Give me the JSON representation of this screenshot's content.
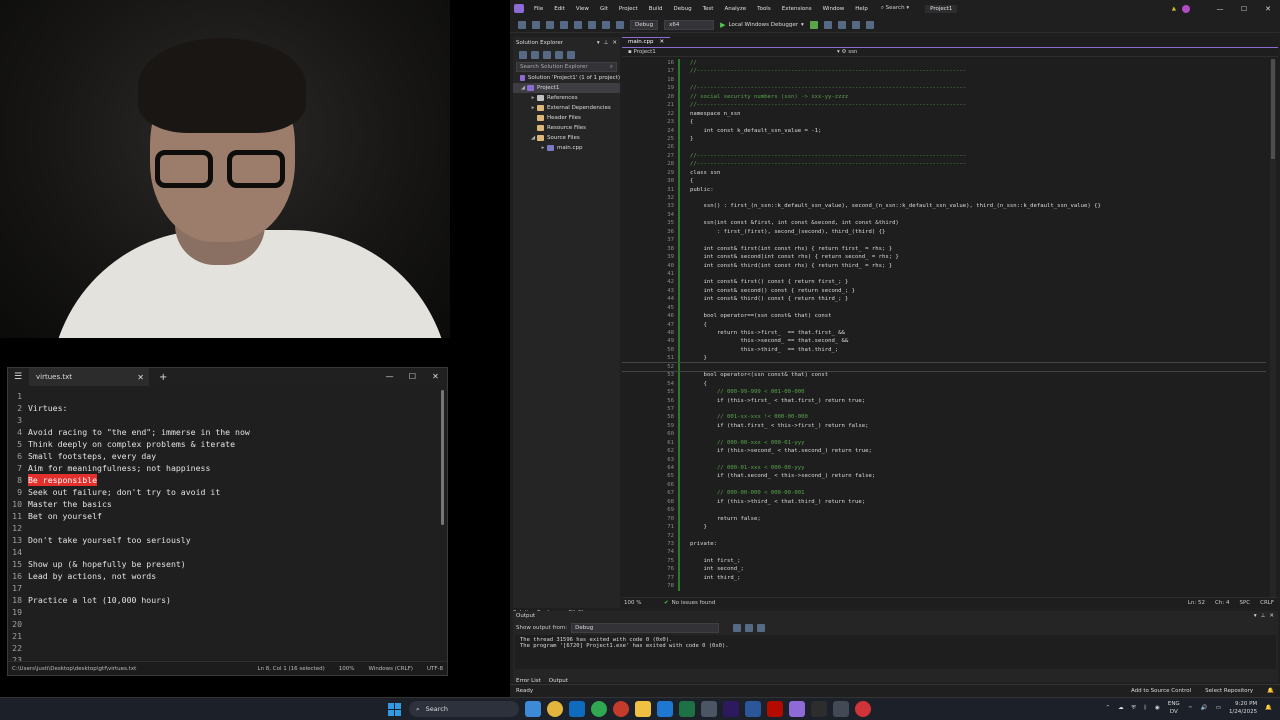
{
  "notepad": {
    "tab_title": "virtues.txt",
    "lines": [
      {
        "n": "1",
        "text": ""
      },
      {
        "n": "2",
        "text": "Virtues:"
      },
      {
        "n": "3",
        "text": ""
      },
      {
        "n": "4",
        "text": "Avoid racing to \"the end\"; immerse in the now"
      },
      {
        "n": "5",
        "text": "Think deeply on complex problems & iterate"
      },
      {
        "n": "6",
        "text": "Small footsteps, every day"
      },
      {
        "n": "7",
        "text": "Aim for meaningfulness; not happiness"
      },
      {
        "n": "8",
        "text": "Be responsible",
        "selected": true
      },
      {
        "n": "9",
        "text": "Seek out failure; don't try to avoid it"
      },
      {
        "n": "10",
        "text": "Master the basics"
      },
      {
        "n": "11",
        "text": "Bet on yourself"
      },
      {
        "n": "12",
        "text": ""
      },
      {
        "n": "13",
        "text": "Don't take yourself too seriously"
      },
      {
        "n": "14",
        "text": ""
      },
      {
        "n": "15",
        "text": "Show up (& hopefully be present)"
      },
      {
        "n": "16",
        "text": "Lead by actions, not words"
      },
      {
        "n": "17",
        "text": ""
      },
      {
        "n": "18",
        "text": "Practice a lot (10,000 hours)"
      },
      {
        "n": "19",
        "text": ""
      },
      {
        "n": "20",
        "text": ""
      },
      {
        "n": "21",
        "text": ""
      },
      {
        "n": "22",
        "text": ""
      },
      {
        "n": "23",
        "text": ""
      }
    ],
    "status": {
      "path": "C:\\Users\\justi\\Desktop\\desktop\\gtf\\virtues.txt",
      "position": "Ln 8, Col 1 (16 selected)",
      "zoom": "100%",
      "line_ending": "Windows (CRLF)",
      "encoding": "UTF-8"
    }
  },
  "vs": {
    "menu": [
      "File",
      "Edit",
      "View",
      "Git",
      "Project",
      "Build",
      "Debug",
      "Test",
      "Analyze",
      "Tools",
      "Extensions",
      "Window",
      "Help"
    ],
    "search_label": "Search",
    "project_title": "Project1",
    "toolbar": {
      "config": "Debug",
      "platform": "x64",
      "run_label": "Local Windows Debugger"
    },
    "solution_explorer": {
      "title": "Solution Explorer",
      "search_placeholder": "Search Solution Explorer",
      "tree": [
        {
          "label": "Solution 'Project1' (1 of 1 project)",
          "icon": "solution",
          "arrow": ""
        },
        {
          "label": "Project1",
          "icon": "project",
          "arrow": "◢",
          "selected": true
        },
        {
          "label": "References",
          "icon": "references",
          "arrow": "▸"
        },
        {
          "label": "External Dependencies",
          "icon": "folder",
          "arrow": "▸"
        },
        {
          "label": "Header Files",
          "icon": "folder",
          "arrow": ""
        },
        {
          "label": "Resource Files",
          "icon": "folder",
          "arrow": ""
        },
        {
          "label": "Source Files",
          "icon": "folder",
          "arrow": "◢"
        },
        {
          "label": "main.cpp",
          "icon": "cpp-file",
          "arrow": "▸"
        }
      ],
      "bottom_tabs": [
        "Solution Explorer",
        "Git Changes"
      ]
    },
    "editor": {
      "tab": "main.cpp",
      "nav_project": "Project1",
      "nav_scope": "ssn",
      "lines": [
        {
          "n": "16",
          "text": "//"
        },
        {
          "n": "17",
          "text": "//--------------------------------------------------------------------------------"
        },
        {
          "n": "18",
          "text": ""
        },
        {
          "n": "19",
          "text": "//--------------------------------------------------------------------------------"
        },
        {
          "n": "20",
          "text": "// social security numbers (ssn) -> xxx-yy-zzzz"
        },
        {
          "n": "21",
          "text": "//--------------------------------------------------------------------------------"
        },
        {
          "n": "22",
          "text": "namespace n_ssn"
        },
        {
          "n": "23",
          "text": "{"
        },
        {
          "n": "24",
          "text": "    int const k_default_ssn_value = -1;"
        },
        {
          "n": "25",
          "text": "}"
        },
        {
          "n": "26",
          "text": ""
        },
        {
          "n": "27",
          "text": "//--------------------------------------------------------------------------------"
        },
        {
          "n": "28",
          "text": "//--------------------------------------------------------------------------------"
        },
        {
          "n": "29",
          "text": "class ssn"
        },
        {
          "n": "30",
          "text": "{"
        },
        {
          "n": "31",
          "text": "public:"
        },
        {
          "n": "32",
          "text": ""
        },
        {
          "n": "33",
          "text": "    ssn() : first_(n_ssn::k_default_ssn_value), second_(n_ssn::k_default_ssn_value), third_(n_ssn::k_default_ssn_value) {}"
        },
        {
          "n": "34",
          "text": ""
        },
        {
          "n": "35",
          "text": "    ssn(int const &first, int const &second, int const &third)"
        },
        {
          "n": "36",
          "text": "        : first_(first), second_(second), third_(third) {}"
        },
        {
          "n": "37",
          "text": ""
        },
        {
          "n": "38",
          "text": "    int const& first(int const rhs) { return first_ = rhs; }"
        },
        {
          "n": "39",
          "text": "    int const& second(int const rhs) { return second_ = rhs; }"
        },
        {
          "n": "40",
          "text": "    int const& third(int const rhs) { return third_ = rhs; }"
        },
        {
          "n": "41",
          "text": ""
        },
        {
          "n": "42",
          "text": "    int const& first() const { return first_; }"
        },
        {
          "n": "43",
          "text": "    int const& second() const { return second_; }"
        },
        {
          "n": "44",
          "text": "    int const& third() const { return third_; }"
        },
        {
          "n": "45",
          "text": ""
        },
        {
          "n": "46",
          "text": "    bool operator==(ssn const& that) const"
        },
        {
          "n": "47",
          "text": "    {"
        },
        {
          "n": "48",
          "text": "        return this->first_  == that.first_ &&"
        },
        {
          "n": "49",
          "text": "               this->second_ == that.second_ &&"
        },
        {
          "n": "50",
          "text": "               this->third_  == that.third_;"
        },
        {
          "n": "51",
          "text": "    }"
        },
        {
          "n": "52",
          "text": "",
          "current": true
        },
        {
          "n": "53",
          "text": "    bool operator<(ssn const& that) const"
        },
        {
          "n": "54",
          "text": "    {"
        },
        {
          "n": "55",
          "text": "        // 000-99-999 < 001-00-000"
        },
        {
          "n": "56",
          "text": "        if (this->first_ < that.first_) return true;"
        },
        {
          "n": "57",
          "text": ""
        },
        {
          "n": "58",
          "text": "        // 001-xx-xxx !< 000-00-000"
        },
        {
          "n": "59",
          "text": "        if (that.first_ < this->first_) return false;"
        },
        {
          "n": "60",
          "text": ""
        },
        {
          "n": "61",
          "text": "        // 000-00-xxx < 000-01-yyy"
        },
        {
          "n": "62",
          "text": "        if (this->second_ < that.second_) return true;"
        },
        {
          "n": "63",
          "text": ""
        },
        {
          "n": "64",
          "text": "        // 000-01-xxx < 000-00-yyy"
        },
        {
          "n": "65",
          "text": "        if (that.second_ < this->second_) return false;"
        },
        {
          "n": "66",
          "text": ""
        },
        {
          "n": "67",
          "text": "        // 000-00-000 < 000-00-001"
        },
        {
          "n": "68",
          "text": "        if (this->third_ < that.third_) return true;"
        },
        {
          "n": "69",
          "text": ""
        },
        {
          "n": "70",
          "text": "        return false;"
        },
        {
          "n": "71",
          "text": "    }"
        },
        {
          "n": "72",
          "text": ""
        },
        {
          "n": "73",
          "text": "private:"
        },
        {
          "n": "74",
          "text": ""
        },
        {
          "n": "75",
          "text": "    int first_;"
        },
        {
          "n": "76",
          "text": "    int second_;"
        },
        {
          "n": "77",
          "text": "    int third_;"
        },
        {
          "n": "78",
          "text": ""
        }
      ],
      "status": {
        "zoom": "100 %",
        "issues": "No issues found",
        "line": "Ln: 52",
        "col": "Ch: 4",
        "spacing": "SPC",
        "line_ending": "CRLF"
      }
    },
    "output": {
      "title": "Output",
      "show_from_label": "Show output from:",
      "source": "Debug",
      "lines": [
        "The thread 31596 has exited with code 0 (0x0).",
        "The program '[6720] Project1.exe' has exited with code 0 (0x0)."
      ],
      "tabs": [
        "Error List",
        "Output"
      ]
    },
    "statusbar": {
      "ready": "Ready",
      "add_source": "Add to Source Control",
      "repo": "Select Repository"
    }
  },
  "taskbar": {
    "search_placeholder": "Search",
    "lang_top": "ENG",
    "lang_bottom": "DV",
    "time": "9:20 PM",
    "date": "1/24/2025"
  },
  "colors": {
    "selection": "#e3302c",
    "accent": "#8d6ad6",
    "comment": "#57a64a",
    "windows_blue": "#2f9be3"
  }
}
